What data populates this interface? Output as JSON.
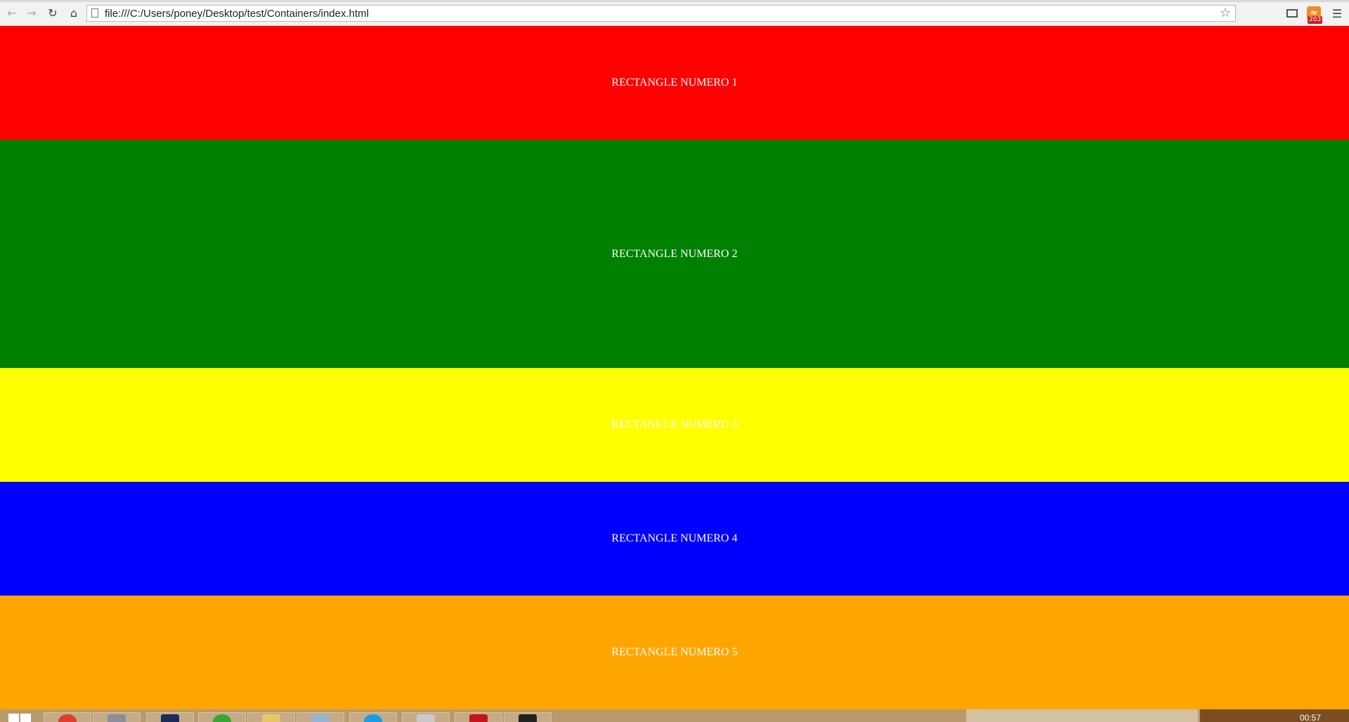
{
  "browser": {
    "url": "file:///C:/Users/poney/Desktop/test/Containers/index.html",
    "rss_badge": "203"
  },
  "rectangles": [
    {
      "label": "RECTANGLE NUMERO 1",
      "color": "#ff0000"
    },
    {
      "label": "RECTANGLE NUMERO 2",
      "color": "#008000"
    },
    {
      "label": "RECTANGLE NUMERO 3",
      "color": "#ffff00"
    },
    {
      "label": "RECTANGLE NUMERO 4",
      "color": "#0000ff"
    },
    {
      "label": "RECTANGLE NUMERO 5",
      "color": "#ffa500"
    }
  ],
  "taskbar": {
    "clock": "00:57"
  },
  "icons": [
    "back-icon",
    "forward-icon",
    "reload-icon",
    "home-icon",
    "page-icon",
    "bookmark-star-icon",
    "cast-icon",
    "rss-icon",
    "menu-icon",
    "windows-start-icon"
  ]
}
